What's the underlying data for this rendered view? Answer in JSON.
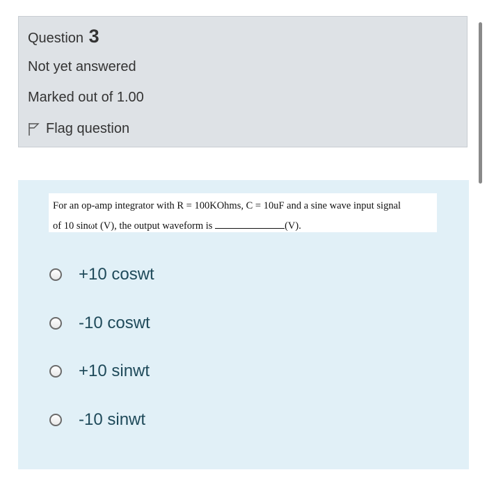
{
  "info": {
    "question_label": "Question",
    "question_number": "3",
    "state": "Not yet answered",
    "grade": "Marked out of 1.00",
    "flag_label": "Flag question",
    "flag_icon": "flag-icon"
  },
  "question": {
    "line1": "For an op-amp integrator with R = 100KOhms, C = 10uF and a sine wave input signal",
    "line2_pre": "of 10 sinωt (V), the output waveform is",
    "line2_post": "(V)."
  },
  "options": [
    {
      "label": "+10 coswt"
    },
    {
      "label": "-10 coswt"
    },
    {
      "label": "+10 sinwt"
    },
    {
      "label": "-10 sinwt"
    }
  ]
}
